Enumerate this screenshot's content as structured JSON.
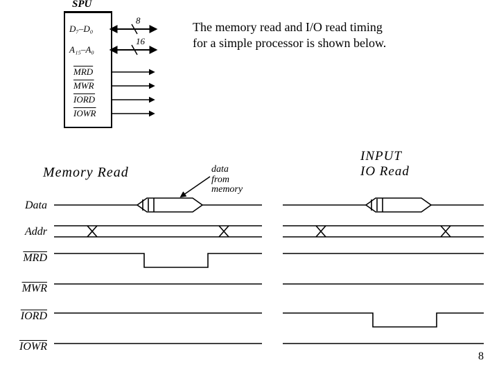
{
  "caption": {
    "line1": "The memory read and I/O read timing",
    "line2": "for a simple processor is shown below."
  },
  "spu": {
    "title": "SPU",
    "pins": {
      "data": "D₇–D₀",
      "addr": "A₁₅–A₀",
      "mrd": "MRD",
      "mwr": "MWR",
      "iord": "IORD",
      "iowr": "IOWR"
    },
    "bus_width": {
      "data": "8",
      "addr": "16"
    }
  },
  "sections": {
    "mem_read": "Memory  Read",
    "io_read": "INPUT\nIO Read"
  },
  "annotation": {
    "data_from_memory": "data\nfrom\nmemory"
  },
  "signals": {
    "data": "Data",
    "addr": "Addr",
    "mrd": "MRD",
    "mwr": "MWR",
    "iord": "IORD",
    "iowr": "IOWR"
  },
  "page_number": "8",
  "chart_data": {
    "type": "timing-diagram",
    "title": "Memory Read and I/O Read timing for a simple processor",
    "cpu_block": {
      "name": "SPU",
      "pins": [
        {
          "name": "D7-D0",
          "width": 8,
          "direction": "bidirectional"
        },
        {
          "name": "A15-A0",
          "width": 16,
          "direction": "bidirectional"
        },
        {
          "name": "MRD",
          "active": "low",
          "direction": "out"
        },
        {
          "name": "MWR",
          "active": "low",
          "direction": "out"
        },
        {
          "name": "IORD",
          "active": "low",
          "direction": "out"
        },
        {
          "name": "IOWR",
          "active": "low",
          "direction": "out"
        }
      ]
    },
    "cycles": [
      {
        "name": "Memory Read",
        "note": "data from memory",
        "signals": {
          "Data": "bus-valid-mid",
          "Addr": "bus-valid-full",
          "MRD": "active-low-pulse",
          "MWR": "high-idle",
          "IORD": "high-idle",
          "IOWR": "high-idle"
        }
      },
      {
        "name": "INPUT IO Read",
        "signals": {
          "Data": "bus-valid-mid",
          "Addr": "bus-valid-full",
          "MRD": "high-idle",
          "MWR": "high-idle",
          "IORD": "active-low-pulse",
          "IOWR": "high-idle"
        }
      }
    ]
  }
}
